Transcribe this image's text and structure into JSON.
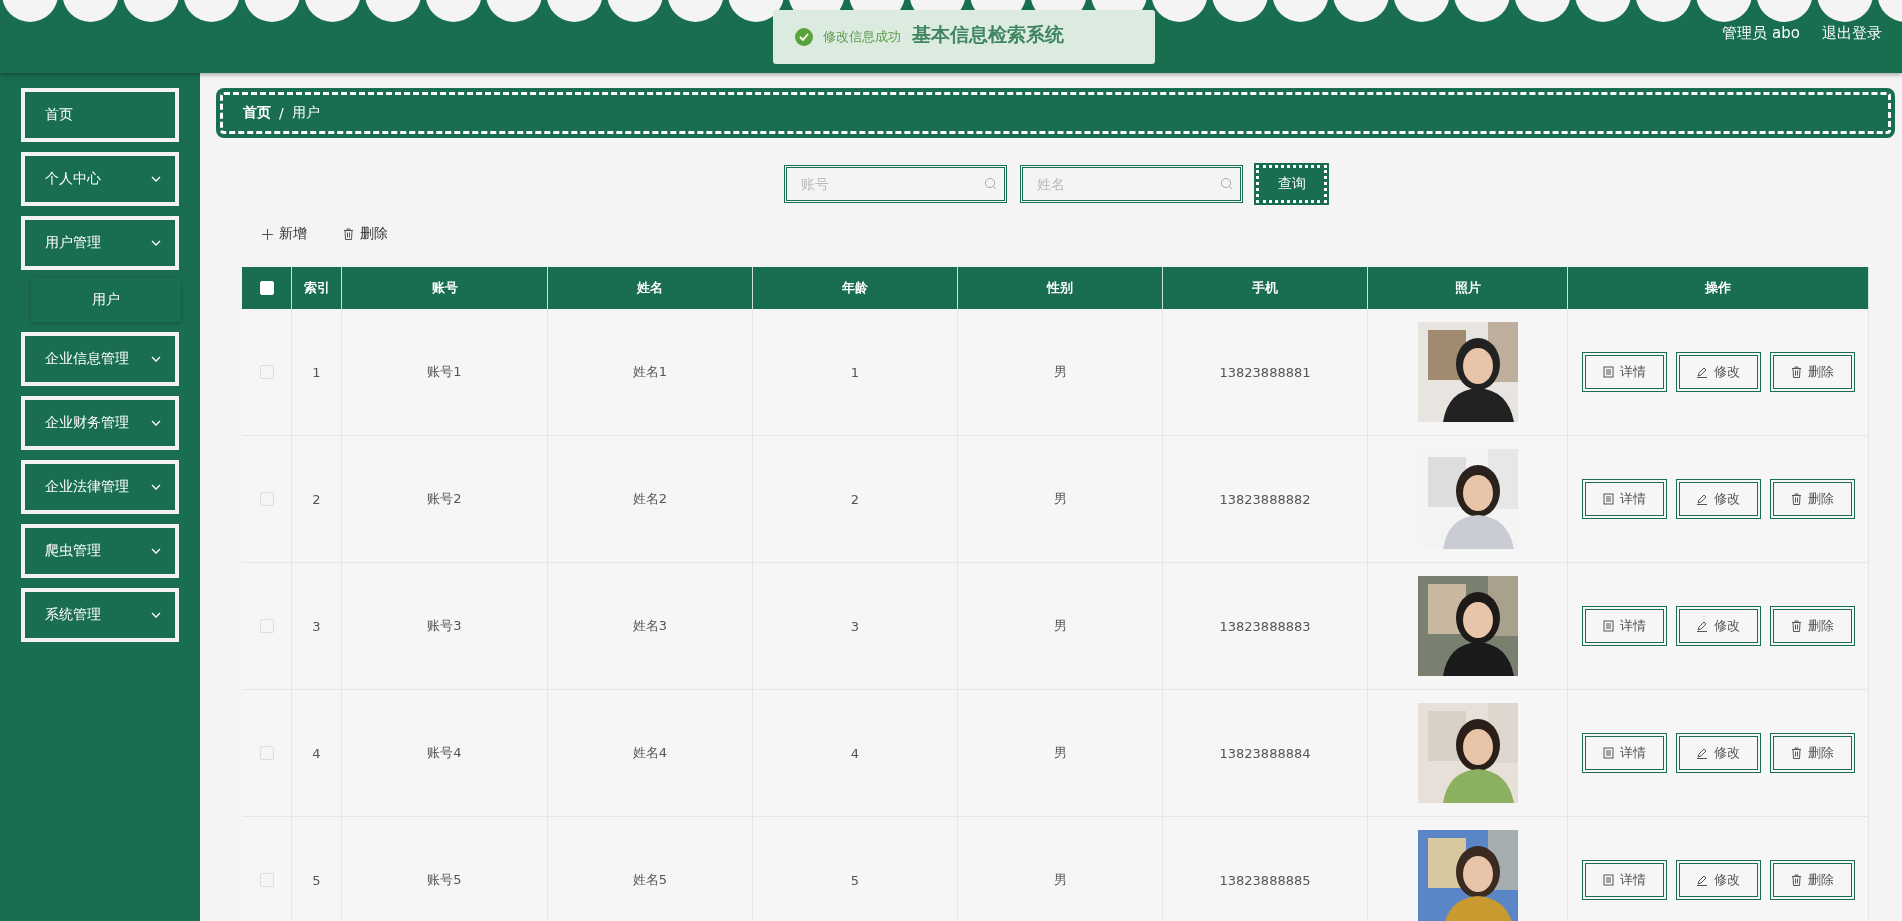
{
  "header": {
    "title": "基本信息检索系统",
    "toast": {
      "message": "修改信息成功"
    },
    "user": "管理员 abo",
    "logout": "退出登录"
  },
  "sidebar": {
    "items": [
      {
        "label": "首页",
        "kind": "link"
      },
      {
        "label": "个人中心",
        "kind": "submenu"
      },
      {
        "label": "用户管理",
        "kind": "submenu",
        "children": [
          {
            "label": "用户"
          }
        ]
      },
      {
        "label": "企业信息管理",
        "kind": "submenu"
      },
      {
        "label": "企业财务管理",
        "kind": "submenu"
      },
      {
        "label": "企业法律管理",
        "kind": "submenu"
      },
      {
        "label": "爬虫管理",
        "kind": "submenu"
      },
      {
        "label": "系统管理",
        "kind": "submenu"
      }
    ]
  },
  "breadcrumb": {
    "items": [
      "首页",
      "用户"
    ],
    "separator": "/"
  },
  "search": {
    "fields": [
      {
        "placeholder": "账号"
      },
      {
        "placeholder": "姓名"
      }
    ],
    "button": "查询"
  },
  "toolbar": {
    "add": "新增",
    "delete": "删除"
  },
  "table": {
    "columns": [
      "索引",
      "账号",
      "姓名",
      "年龄",
      "性别",
      "手机",
      "照片",
      "操作"
    ],
    "header_checked": false,
    "rows": [
      {
        "checked": false,
        "cells": [
          "1",
          "账号1",
          "姓名1",
          "1",
          "男",
          "13823888881"
        ],
        "actions": [
          "详情",
          "修改",
          "删除"
        ]
      },
      {
        "checked": false,
        "cells": [
          "2",
          "账号2",
          "姓名2",
          "2",
          "男",
          "13823888882"
        ],
        "actions": [
          "详情",
          "修改",
          "删除"
        ]
      },
      {
        "checked": false,
        "cells": [
          "3",
          "账号3",
          "姓名3",
          "3",
          "男",
          "13823888883"
        ],
        "actions": [
          "详情",
          "修改",
          "删除"
        ]
      },
      {
        "checked": false,
        "cells": [
          "4",
          "账号4",
          "姓名4",
          "4",
          "男",
          "13823888884"
        ],
        "actions": [
          "详情",
          "修改",
          "删除"
        ]
      },
      {
        "checked": false,
        "cells": [
          "5",
          "账号5",
          "姓名5",
          "5",
          "男",
          "13823888885"
        ],
        "actions": [
          "详情",
          "修改",
          "删除"
        ]
      }
    ]
  }
}
